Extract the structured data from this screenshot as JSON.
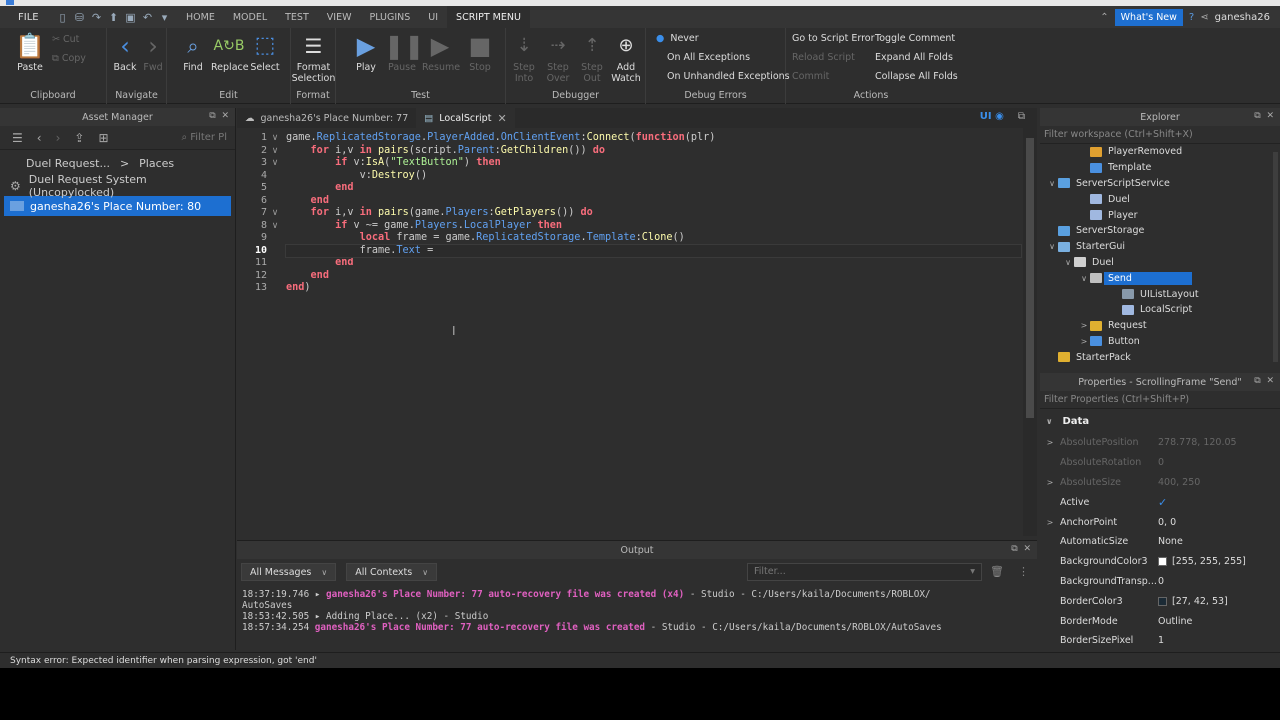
{
  "menubar": {
    "file": "FILE",
    "tabs": [
      "HOME",
      "MODEL",
      "TEST",
      "VIEW",
      "PLUGINS",
      "UI",
      "SCRIPT MENU"
    ],
    "active_tab": "SCRIPT MENU",
    "whats_new": "What's New",
    "username": "ganesha26"
  },
  "ribbon": {
    "clipboard": {
      "label": "Clipboard",
      "paste": "Paste",
      "cut": "Cut",
      "copy": "Copy"
    },
    "navigate": {
      "label": "Navigate",
      "back": "Back",
      "fwd": "Fwd"
    },
    "edit": {
      "label": "Edit",
      "find": "Find",
      "replace": "Replace",
      "select": "Select"
    },
    "format": {
      "label": "Format",
      "format_selection": "Format Selection"
    },
    "test": {
      "label": "Test",
      "play": "Play",
      "pause": "Pause",
      "resume": "Resume",
      "stop": "Stop"
    },
    "debugger": {
      "label": "Debugger",
      "step_into": "Step Into",
      "step_over": "Step Over",
      "step_out": "Step Out",
      "add_watch": "Add Watch"
    },
    "debug_errors": {
      "label": "Debug Errors",
      "never": "Never",
      "on_all": "On All Exceptions",
      "on_unhandled": "On Unhandled Exceptions"
    },
    "actions": {
      "label": "Actions",
      "go_to_error": "Go to Script Error",
      "reload": "Reload Script",
      "commit": "Commit",
      "toggle_comment": "Toggle Comment",
      "expand_all": "Expand All Folds",
      "collapse_all": "Collapse All Folds"
    }
  },
  "asset_manager": {
    "title": "Asset Manager",
    "filter_placeholder": "Filter Pl",
    "breadcrumb_root": "Duel Request...",
    "breadcrumb_sep": ">",
    "breadcrumb_current": "Places",
    "items": [
      "Duel Request System (Uncopylocked)",
      "ganesha26's Place Number: 80"
    ]
  },
  "editor": {
    "tabs": [
      {
        "label": "ganesha26's Place Number: 77"
      },
      {
        "label": "LocalScript"
      }
    ],
    "ui_badge": "UI",
    "current_line": 10,
    "line_numbers": [
      "1",
      "2",
      "3",
      "4",
      "5",
      "6",
      "7",
      "8",
      "9",
      "10",
      "11",
      "12",
      "13"
    ]
  },
  "output": {
    "title": "Output",
    "messages_filter": "All Messages",
    "contexts_filter": "All Contexts",
    "filter_placeholder": "Filter...",
    "lines": [
      {
        "time": "18:37:19.746",
        "arrow": "▸",
        "msg": "ganesha26's Place Number: 77 auto-recovery file was created (x4)",
        "rest": "  -  Studio - C:/Users/kaila/Documents/ROBLOX/"
      },
      {
        "time": "AutoSaves",
        "arrow": "",
        "msg": "",
        "rest": ""
      },
      {
        "time": "18:53:42.505",
        "arrow": "▸",
        "msg": "",
        "rest": "Adding Place... (x2)  -  Studio"
      },
      {
        "time": "18:57:34.254",
        "arrow": "",
        "msg": "ganesha26's Place Number: 77 auto-recovery file was created",
        "rest": "  -  Studio - C:/Users/kaila/Documents/ROBLOX/AutoSaves"
      }
    ]
  },
  "status": {
    "text": "Syntax error: Expected identifier when parsing expression, got 'end'"
  },
  "explorer": {
    "title": "Explorer",
    "filter_placeholder": "Filter workspace (Ctrl+Shift+X)",
    "nodes": [
      {
        "label": "PlayerRemoved",
        "indent": 3,
        "arrow": "",
        "color": "#e0a030"
      },
      {
        "label": "Template",
        "indent": 3,
        "arrow": "",
        "color": "#4a90e0"
      },
      {
        "label": "ServerScriptService",
        "indent": 1,
        "arrow": "∨",
        "color": "#5aa0e0"
      },
      {
        "label": "Duel",
        "indent": 3,
        "arrow": "",
        "color": "#a0b8e0"
      },
      {
        "label": "Player",
        "indent": 3,
        "arrow": "",
        "color": "#a0b8e0"
      },
      {
        "label": "ServerStorage",
        "indent": 1,
        "arrow": "",
        "color": "#5aa0e0"
      },
      {
        "label": "StarterGui",
        "indent": 1,
        "arrow": "∨",
        "color": "#7ab0e0"
      },
      {
        "label": "Duel",
        "indent": 2,
        "arrow": "∨",
        "color": "#d0d0d0"
      },
      {
        "label": "Send",
        "indent": 3,
        "arrow": "∨",
        "color": "#c0c0c0",
        "selected": true
      },
      {
        "label": "UIListLayout",
        "indent": 5,
        "arrow": "",
        "color": "#8899aa"
      },
      {
        "label": "LocalScript",
        "indent": 5,
        "arrow": "",
        "color": "#a0b8e0"
      },
      {
        "label": "Request",
        "indent": 3,
        "arrow": ">",
        "color": "#e0b030"
      },
      {
        "label": "Button",
        "indent": 3,
        "arrow": ">",
        "color": "#4a90e0"
      },
      {
        "label": "StarterPack",
        "indent": 1,
        "arrow": "",
        "color": "#e0b030"
      }
    ]
  },
  "properties": {
    "title": "Properties - ScrollingFrame \"Send\"",
    "filter_placeholder": "Filter Properties (Ctrl+Shift+P)",
    "section": "Data",
    "rows": [
      {
        "name": "AbsolutePosition",
        "value": "278.778, 120.05",
        "arrow": ">",
        "dim": true
      },
      {
        "name": "AbsoluteRotation",
        "value": "0",
        "arrow": "",
        "dim": true
      },
      {
        "name": "AbsoluteSize",
        "value": "400, 250",
        "arrow": ">",
        "dim": true
      },
      {
        "name": "Active",
        "value": "✓",
        "arrow": "",
        "dim": false,
        "kind": "check"
      },
      {
        "name": "AnchorPoint",
        "value": "0, 0",
        "arrow": ">",
        "dim": false
      },
      {
        "name": "AutomaticSize",
        "value": "None",
        "arrow": "",
        "dim": false
      },
      {
        "name": "BackgroundColor3",
        "value": "[255, 255, 255]",
        "arrow": "",
        "dim": false,
        "swatch": "#ffffff"
      },
      {
        "name": "BackgroundTransp...",
        "value": "0",
        "arrow": "",
        "dim": false
      },
      {
        "name": "BorderColor3",
        "value": "[27, 42, 53]",
        "arrow": "",
        "dim": false,
        "swatch": "#1b2a35"
      },
      {
        "name": "BorderMode",
        "value": "Outline",
        "arrow": "",
        "dim": false
      },
      {
        "name": "BorderSizePixel",
        "value": "1",
        "arrow": "",
        "dim": false
      }
    ]
  },
  "code_lines": [
    [
      [
        "op",
        "game."
      ],
      [
        "pr",
        "ReplicatedStorage"
      ],
      [
        "op",
        "."
      ],
      [
        "pr",
        "PlayerAdded"
      ],
      [
        "op",
        "."
      ],
      [
        "pr",
        "OnClientEvent"
      ],
      [
        "op",
        ":"
      ],
      [
        "fn",
        "Connect"
      ],
      [
        "op",
        "("
      ],
      [
        "kw",
        "function"
      ],
      [
        "op",
        "(plr)"
      ]
    ],
    [
      [
        "op",
        "    "
      ],
      [
        "kw",
        "for"
      ],
      [
        "op",
        " i,v "
      ],
      [
        "kw",
        "in"
      ],
      [
        "op",
        " "
      ],
      [
        "fn",
        "pairs"
      ],
      [
        "op",
        "(script."
      ],
      [
        "pr",
        "Parent"
      ],
      [
        "op",
        ":"
      ],
      [
        "fn",
        "GetChildren"
      ],
      [
        "op",
        "()) "
      ],
      [
        "kw",
        "do"
      ]
    ],
    [
      [
        "op",
        "        "
      ],
      [
        "kw",
        "if"
      ],
      [
        "op",
        " v:"
      ],
      [
        "fn",
        "IsA"
      ],
      [
        "op",
        "("
      ],
      [
        "st",
        "\"TextButton\""
      ],
      [
        "op",
        ") "
      ],
      [
        "kw",
        "then"
      ]
    ],
    [
      [
        "op",
        "            v:"
      ],
      [
        "fn",
        "Destroy"
      ],
      [
        "op",
        "()"
      ]
    ],
    [
      [
        "op",
        "        "
      ],
      [
        "kw",
        "end"
      ]
    ],
    [
      [
        "op",
        "    "
      ],
      [
        "kw",
        "end"
      ]
    ],
    [
      [
        "op",
        "    "
      ],
      [
        "kw",
        "for"
      ],
      [
        "op",
        " i,v "
      ],
      [
        "kw",
        "in"
      ],
      [
        "op",
        " "
      ],
      [
        "fn",
        "pairs"
      ],
      [
        "op",
        "(game."
      ],
      [
        "pr",
        "Players"
      ],
      [
        "op",
        ":"
      ],
      [
        "fn",
        "GetPlayers"
      ],
      [
        "op",
        "()) "
      ],
      [
        "kw",
        "do"
      ]
    ],
    [
      [
        "op",
        "        "
      ],
      [
        "kw",
        "if"
      ],
      [
        "op",
        " v ~= game."
      ],
      [
        "pr",
        "Players"
      ],
      [
        "op",
        "."
      ],
      [
        "pr",
        "LocalPlayer"
      ],
      [
        "op",
        " "
      ],
      [
        "kw",
        "then"
      ]
    ],
    [
      [
        "op",
        "            "
      ],
      [
        "kw",
        "local"
      ],
      [
        "op",
        " frame = game."
      ],
      [
        "pr",
        "ReplicatedStorage"
      ],
      [
        "op",
        "."
      ],
      [
        "pr",
        "Template"
      ],
      [
        "op",
        ":"
      ],
      [
        "fn",
        "Clone"
      ],
      [
        "op",
        "()"
      ]
    ],
    [
      [
        "op",
        "            frame."
      ],
      [
        "pr",
        "Text"
      ],
      [
        "op",
        " ="
      ]
    ],
    [
      [
        "op",
        "        "
      ],
      [
        "kw",
        "end"
      ]
    ],
    [
      [
        "op",
        "    "
      ],
      [
        "kw",
        "end"
      ]
    ],
    [
      [
        "kw",
        "end"
      ],
      [
        "op",
        ")"
      ]
    ]
  ]
}
